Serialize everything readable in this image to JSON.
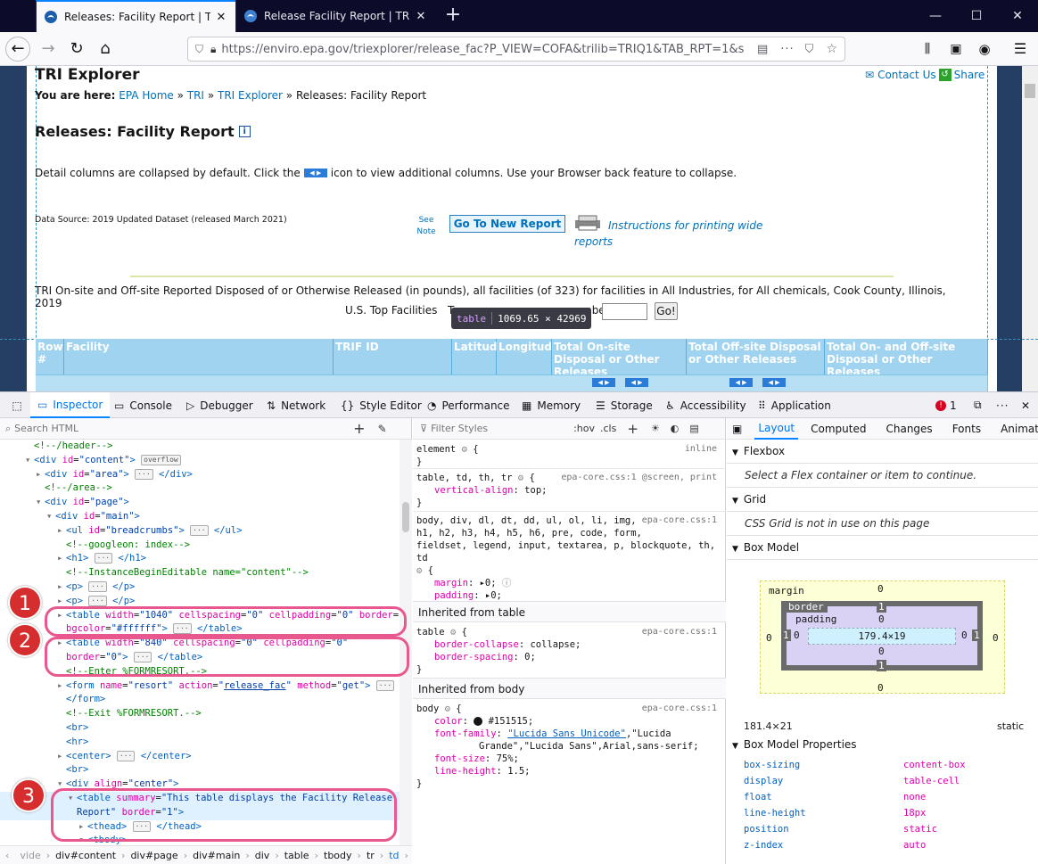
{
  "browser": {
    "tabs": [
      {
        "title": "Releases: Facility Report | TRI Ex",
        "active": true
      },
      {
        "title": "Release Facility Report | TRI Exp",
        "active": false
      }
    ],
    "new_tab": "+",
    "url": "https://enviro.epa.gov/triexplorer/release_fac?P_VIEW=COFA&trilib=TRIQ1&TAB_RPT=1&s"
  },
  "page": {
    "site_title": "TRI Explorer",
    "contact_us": "Contact Us",
    "share": "Share",
    "you_are_here": "You are here:",
    "breadcrumbs": [
      "EPA Home",
      "TRI",
      "TRI Explorer"
    ],
    "breadcrumb_sep": "»",
    "breadcrumb_current": "Releases: Facility Report",
    "heading": "Releases: Facility Report",
    "info_icon": "i",
    "detail_text_1": "Detail columns are collapsed by default. Click the",
    "detail_text_2": "icon to view additional columns. Use your Browser back feature to collapse.",
    "data_source": "Data Source: 2019 Updated Dataset (released March 2021)",
    "see": "See",
    "note": "Note",
    "go_new_report": "Go To New Report",
    "instructions_1": "Instructions for printing wide",
    "instructions_2": "reports",
    "report_desc": "TRI On-site and Off-site Reported Disposed of or Otherwise Released (in pounds), all facilities (of 323) for facilities in All Industries, for All chemicals, Cook County, Illinois, 2019",
    "top_facilities": "U.S. Top Facilities",
    "top_facilities_partial": "T",
    "number_label": "mber",
    "go_button": "Go!",
    "tooltip_tag": "table",
    "tooltip_size": "1069.65 × 42969",
    "columns": [
      "Row #",
      "Facility",
      "TRIF ID",
      "Latitude",
      "Longitude",
      "Total On-site Disposal or Other Releases",
      "Total Off-site Disposal or Other Releases",
      "Total On- and Off-site Disposal or Other Releases"
    ],
    "expand_glyph": "◀ ▶"
  },
  "devtools": {
    "tabs": [
      "Inspector",
      "Console",
      "Debugger",
      "Network",
      "Style Editor",
      "Performance",
      "Memory",
      "Storage",
      "Accessibility",
      "Application"
    ],
    "active_tab": "Inspector",
    "error_count": "1",
    "search_placeholder": "Search HTML",
    "html_lines": [
      {
        "indent": 0,
        "html": "<span class='cmt'>&lt;!--/header--&gt;</span>"
      },
      {
        "indent": 0,
        "tri": "▾",
        "html": "<span class='tag'>&lt;div</span> <span class='att'>id</span>=<span class='val'>\"content\"</span><span class='tag'>&gt;</span> <span class='badge'>overflow</span>"
      },
      {
        "indent": 1,
        "tri": "▸",
        "html": "<span class='tag'>&lt;div</span> <span class='att'>id</span>=<span class='val'>\"area\"</span><span class='tag'>&gt;</span> <span class='badge'>···</span> <span class='tag'>&lt;/div&gt;</span>"
      },
      {
        "indent": 1,
        "html": "<span class='cmt'>&lt;!--/area--&gt;</span>"
      },
      {
        "indent": 1,
        "tri": "▾",
        "html": "<span class='tag'>&lt;div</span> <span class='att'>id</span>=<span class='val'>\"page\"</span><span class='tag'>&gt;</span>"
      },
      {
        "indent": 2,
        "tri": "▾",
        "html": "<span class='tag'>&lt;div</span> <span class='att'>id</span>=<span class='val'>\"main\"</span><span class='tag'>&gt;</span>"
      },
      {
        "indent": 3,
        "tri": "▸",
        "html": "<span class='tag'>&lt;ul</span> <span class='att'>id</span>=<span class='val'>\"breadcrumbs\"</span><span class='tag'>&gt;</span> <span class='badge'>···</span> <span class='tag'>&lt;/ul&gt;</span>"
      },
      {
        "indent": 3,
        "html": "<span class='cmt'>&lt;!--googleon: index--&gt;</span>"
      },
      {
        "indent": 3,
        "tri": "▸",
        "html": "<span class='tag'>&lt;h1&gt;</span> <span class='badge'>···</span> <span class='tag'>&lt;/h1&gt;</span>"
      },
      {
        "indent": 3,
        "html": "<span class='cmt'>&lt;!--InstanceBeginEditable name=\"content\"--&gt;</span>"
      },
      {
        "indent": 3,
        "tri": "▸",
        "html": "<span class='tag'>&lt;p&gt;</span> <span class='badge'>···</span> <span class='tag'>&lt;/p&gt;</span>"
      },
      {
        "indent": 3,
        "tri": "▸",
        "html": "<span class='tag'>&lt;p&gt;</span> <span class='badge'>···</span> <span class='tag'>&lt;/p&gt;</span>"
      },
      {
        "indent": 3,
        "tri": "▸",
        "html": "<span class='tag'>&lt;table</span> <span class='att'>width</span>=<span class='val'>\"1040\"</span> <span class='att'>cellspacing</span>=<span class='val'>\"0\"</span> <span class='att'>cellpadding</span>=<span class='val'>\"0\"</span> <span class='att'>border</span>=<span class='val'>\"1\"</span>"
      },
      {
        "indent": 3,
        "html": "<span class='att'>bgcolor</span>=<span class='val'>\"#ffffff\"</span><span class='tag'>&gt;</span> <span class='badge'>···</span> <span class='tag'>&lt;/table&gt;</span>"
      },
      {
        "indent": 3,
        "tri": "▸",
        "html": "<span class='tag'>&lt;table</span> <span class='att'>width</span>=<span class='val'>\"840\"</span> <span class='att'>cellspacing</span>=<span class='val'>\"0\"</span> <span class='att'>cellpadding</span>=<span class='val'>\"0\"</span>"
      },
      {
        "indent": 3,
        "html": "<span class='att'>border</span>=<span class='val'>\"0\"</span><span class='tag'>&gt;</span> <span class='badge'>···</span> <span class='tag'>&lt;/table&gt;</span>"
      },
      {
        "indent": 3,
        "html": "<span class='cmt'>&lt;!--Enter %FORMRESORT.--&gt;</span>"
      },
      {
        "indent": 3,
        "tri": "▸",
        "html": "<span class='tag'>&lt;form</span> <span class='att'>name</span>=<span class='val'>\"resort\"</span> <span class='att'>action</span>=<span class='val'>\"<u>release_fac</u>\"</span> <span class='att'>method</span>=<span class='val'>\"get\"</span><span class='tag'>&gt;</span> <span class='badge'>···</span>"
      },
      {
        "indent": 3,
        "html": "<span class='tag'>&lt;/form&gt;</span>"
      },
      {
        "indent": 3,
        "html": "<span class='cmt'>&lt;!--Exit %FORMRESORT.--&gt;</span>"
      },
      {
        "indent": 3,
        "html": "<span class='tag'>&lt;br&gt;</span>"
      },
      {
        "indent": 3,
        "html": "<span class='tag'>&lt;hr&gt;</span>"
      },
      {
        "indent": 3,
        "tri": "▸",
        "html": "<span class='tag'>&lt;center&gt;</span> <span class='badge'>···</span> <span class='tag'>&lt;/center&gt;</span>"
      },
      {
        "indent": 3,
        "html": "<span class='tag'>&lt;br&gt;</span>"
      },
      {
        "indent": 3,
        "tri": "▾",
        "html": "<span class='tag'>&lt;div</span> <span class='att'>align</span>=<span class='val'>\"center\"</span><span class='tag'>&gt;</span>"
      },
      {
        "indent": 4,
        "tri": "▾",
        "html": "<span class='tag'>&lt;table</span> <span class='att'>summary</span>=<span class='val'>\"This table displays the Facility Release</span>",
        "sel": true
      },
      {
        "indent": 4,
        "html": "<span class='val'>Report\"</span> <span class='att'>border</span>=<span class='val'>\"1\"</span><span class='tag'>&gt;</span>",
        "sel": true
      },
      {
        "indent": 5,
        "tri": "▸",
        "html": "<span class='tag'>&lt;thead&gt;</span> <span class='badge'>···</span> <span class='tag'>&lt;/thead&gt;</span>"
      },
      {
        "indent": 5,
        "tri": "▾",
        "html": "<span class='tag'>&lt;tbody&gt;</span>"
      }
    ],
    "html_breadcrumbs": [
      "vide",
      "div#content",
      "div#page",
      "div#main",
      "div",
      "table",
      "tbody",
      "tr",
      "td"
    ],
    "callouts": [
      "1",
      "2",
      "3"
    ],
    "filter_placeholder": "Filter Styles",
    "hov": ":hov",
    "cls": ".cls",
    "rules": {
      "element": "element",
      "inline": "inline",
      "r1_sel": "table, td, th, tr",
      "r1_src": "epa-core.css:1 @screen, print",
      "r1_prop": "vertical-align",
      "r1_val": "top;",
      "r2_sel_1": "body, div, dl, dt, dd, ul, ol, li, img,",
      "r2_src": "epa-core.css:1",
      "r2_sel_2": "h1, h2, h3, h4, h5, h6, pre, code, form,",
      "r2_sel_3": "fieldset, legend, input, textarea, p, blockquote, th, td",
      "r2_p1": "margin",
      "r2_v1": "0;",
      "r2_p2": "padding",
      "r2_v2": "0;",
      "inh_table": "Inherited from table",
      "r3_sel": "table",
      "r3_src": "epa-core.css:1",
      "r3_p1": "border-collapse",
      "r3_v1": "collapse;",
      "r3_p2": "border-spacing",
      "r3_v2": "0;",
      "inh_body": "Inherited from body",
      "r4_sel": "body",
      "r4_src": "epa-core.css:1",
      "r4_p1": "color",
      "r4_v1": "#151515;",
      "r4_p2": "font-family",
      "r4_v2a": "\"Lucida Sans Unicode\"",
      "r4_v2b": ",\"Lucida",
      "r4_v2c": "Grande\",\"Lucida Sans\",Arial,sans-serif;",
      "r4_p3": "font-size",
      "r4_v3": "75%;",
      "r4_p4": "line-height",
      "r4_v4": "1.5;"
    },
    "layout_tabs": [
      "Layout",
      "Computed",
      "Changes",
      "Fonts",
      "Animat"
    ],
    "flexbox": "Flexbox",
    "flexbox_msg": "Select a Flex container or item to continue.",
    "grid": "Grid",
    "grid_msg": "CSS Grid is not in use on this page",
    "box_model": "Box Model",
    "bm": {
      "margin": "margin",
      "border": "border",
      "padding": "padding",
      "content": "179.4×19",
      "zero": "0",
      "one": "1"
    },
    "dims": "181.4×21",
    "position_val": "static",
    "bmp_title": "Box Model Properties",
    "bmp_props": [
      {
        "k": "box-sizing",
        "v": "content-box"
      },
      {
        "k": "display",
        "v": "table-cell"
      },
      {
        "k": "float",
        "v": "none"
      },
      {
        "k": "line-height",
        "v": "18px"
      },
      {
        "k": "position",
        "v": "static"
      },
      {
        "k": "z-index",
        "v": "auto"
      }
    ]
  },
  "colors": {
    "accent": "#0a84ff",
    "callout": "#e8588f",
    "callout_badge": "#d62e2e",
    "table_header": "#9fd3ef",
    "link": "#0071bc"
  }
}
